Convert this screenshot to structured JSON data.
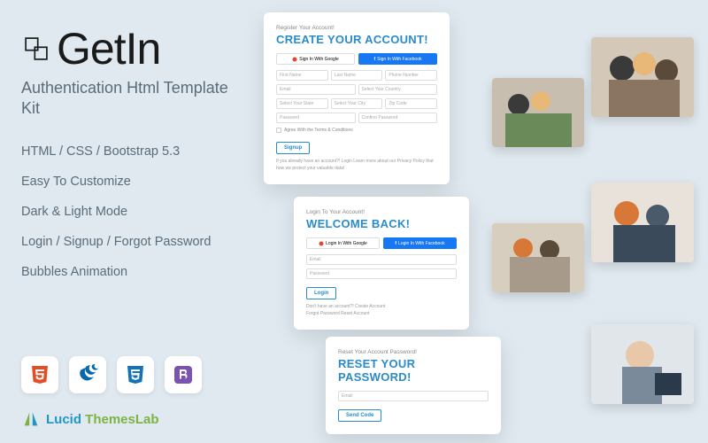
{
  "brand": "GetIn",
  "subtitle": "Authentication Html Template Kit",
  "features": [
    "HTML / CSS / Bootstrap 5.3",
    "Easy To Customize",
    "Dark & Light Mode",
    "Login / Signup / Forgot Password",
    "Bubbles Animation"
  ],
  "tech": [
    "HTML5",
    "jQuery",
    "CSS3",
    "Bootstrap"
  ],
  "vendor": {
    "lucid": "Lucid ",
    "themes": "ThemesLab"
  },
  "signup": {
    "small": "Register Your Account!",
    "title": "CREATE YOUR ACCOUNT!",
    "google": "Sign In With Google",
    "facebook": "Sign In With Facebook",
    "fields": {
      "first": "First Name",
      "last": "Last Name",
      "phone": "Phone Number",
      "email": "Email",
      "country": "Select Your Country",
      "state": "Select Your State",
      "city": "Select Your City",
      "zip": "Zip Code",
      "password": "Password",
      "confirm": "Confirm Password"
    },
    "terms": "Agree With the Terms & Conditions",
    "btn": "Signup",
    "footer": "If you already have an account?! Login\nLearn more about our Privacy Policy that how we protect your valuable data!"
  },
  "login": {
    "small": "Login To Your Account!",
    "title": "WELCOME BACK!",
    "google": "Login In With Google",
    "facebook": "Login In With Facebook",
    "email": "Email",
    "password": "Password",
    "btn": "Login",
    "footer1": "Don't have an account?! Create Account",
    "footer2": "Forgot Password Reset Account"
  },
  "reset": {
    "small": "Reset Your Account Password!",
    "title": "RESET YOUR PASSWORD!",
    "email": "Email",
    "btn": "Send Code"
  }
}
